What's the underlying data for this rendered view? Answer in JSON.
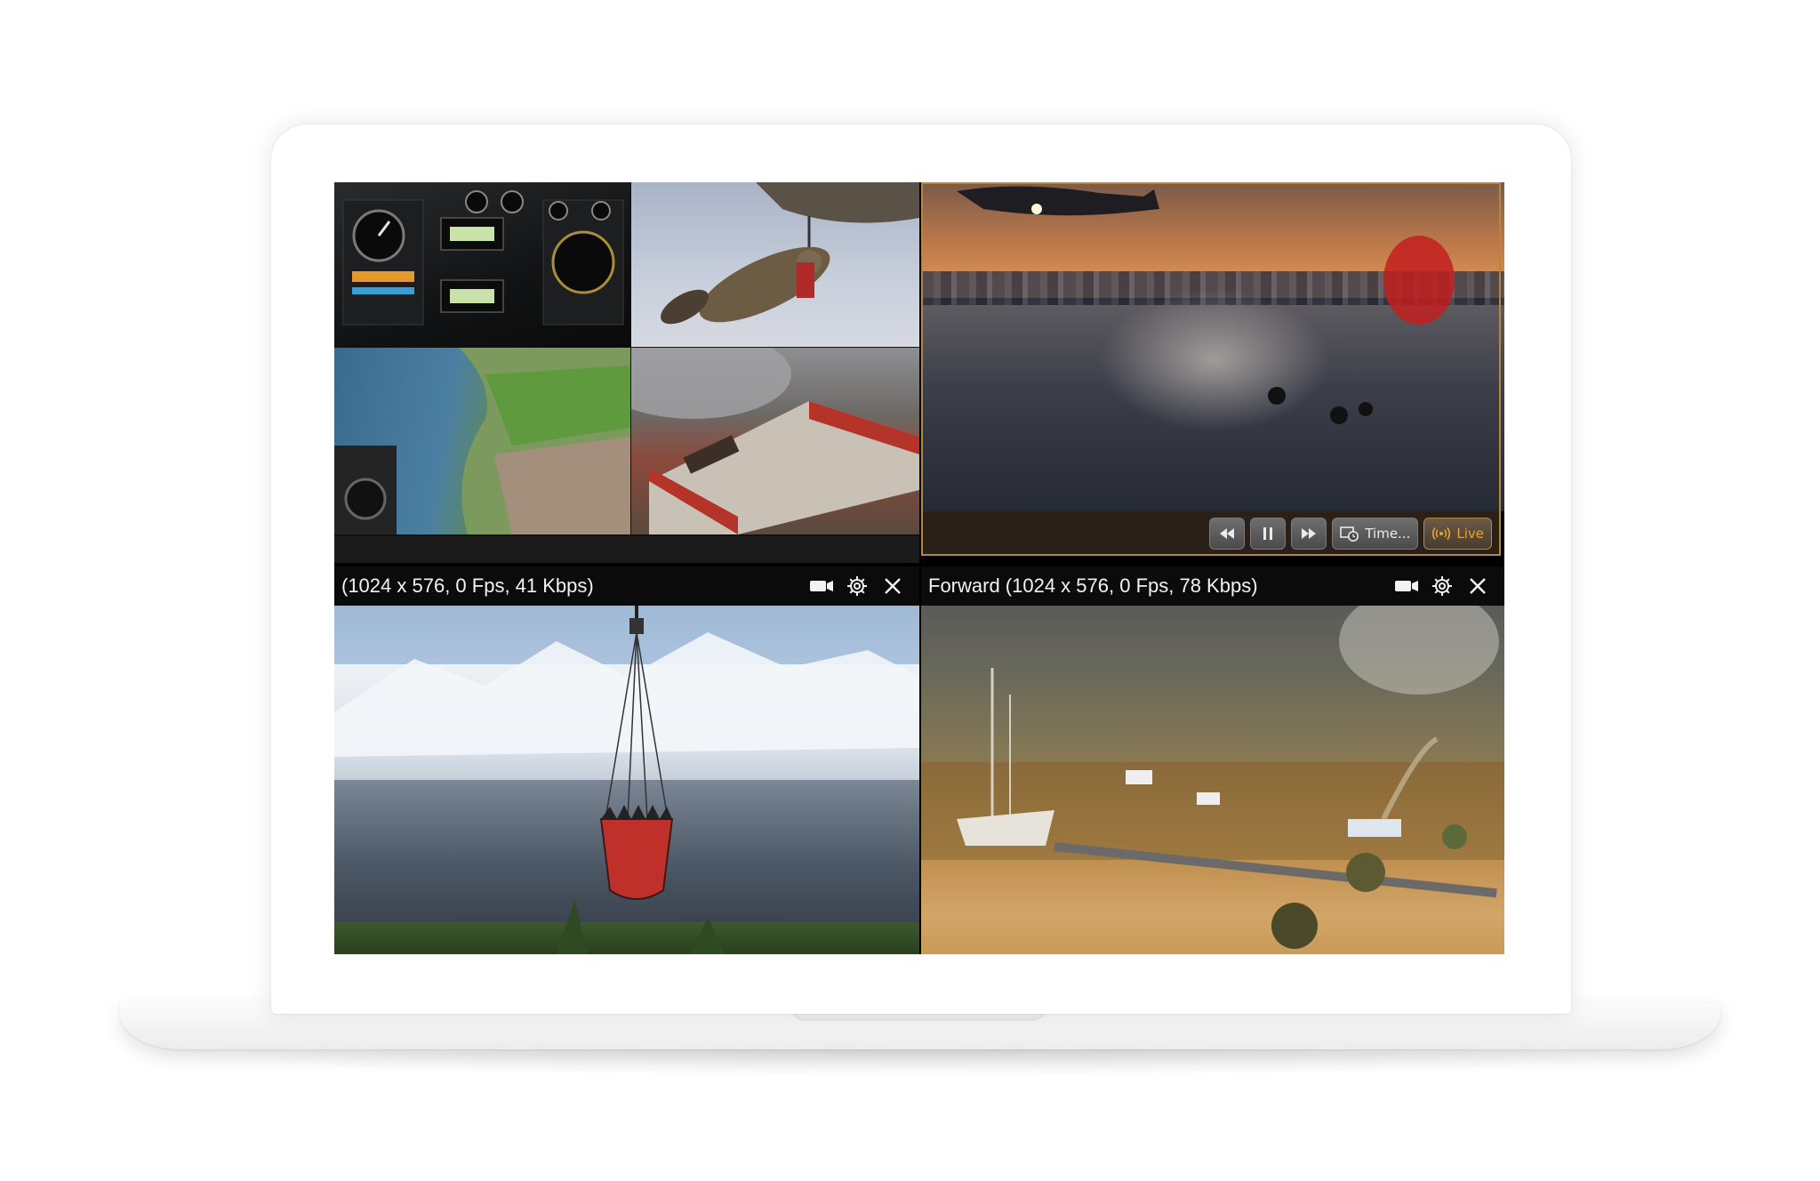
{
  "panes": [
    {
      "id": "multi-view",
      "subtiles": [
        "cockpit",
        "rappel",
        "lake",
        "fire-building"
      ]
    },
    {
      "id": "sea-rescue",
      "controls": {
        "rewind_icon": "rewind-icon",
        "pause_icon": "pause-icon",
        "forward_icon": "fast-forward-icon",
        "timeline_label": "Time...",
        "live_label": "Live"
      }
    },
    {
      "id": "mountain-bucket",
      "title": "(1024 x 576, 0 Fps, 41 Kbps)",
      "icons": [
        "camera-icon",
        "settings-icon",
        "close-icon"
      ]
    },
    {
      "id": "forward",
      "title": "Forward (1024 x 576, 0 Fps, 78 Kbps)",
      "icons": [
        "camera-icon",
        "settings-icon",
        "close-icon"
      ]
    }
  ],
  "colors": {
    "active_border": "#b8863b",
    "live_accent": "#e8a23a",
    "titlebar_bg": "#0b0b0b"
  }
}
